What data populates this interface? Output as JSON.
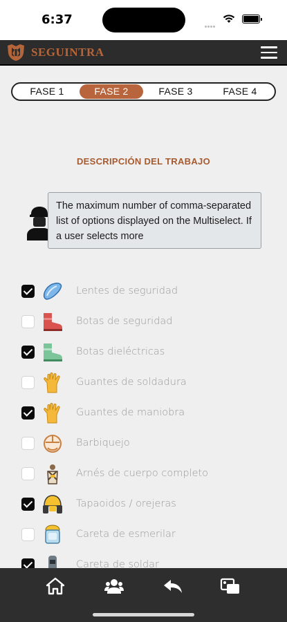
{
  "status_bar": {
    "time": "6:37"
  },
  "header": {
    "brand_name": "SEGUINTRA"
  },
  "phases": [
    {
      "label": "FASE 1",
      "active": false
    },
    {
      "label": "FASE 2",
      "active": true
    },
    {
      "label": "FASE 3",
      "active": false
    },
    {
      "label": "FASE 4",
      "active": false
    }
  ],
  "section": {
    "title": "DESCRIPCIÓN DEL TRABAJO",
    "worker_icon": "worker-helmet-icon",
    "tooltip_text": "The maximum number of comma-separated list of options displayed on the Multiselect. If a user selects more"
  },
  "checklist": [
    {
      "label": "Lentes de seguridad",
      "checked": true,
      "icon": "safety-glasses-icon"
    },
    {
      "label": "Botas de seguridad",
      "checked": false,
      "icon": "red-boot-icon"
    },
    {
      "label": "Botas dieléctricas",
      "checked": true,
      "icon": "green-boot-icon"
    },
    {
      "label": "Guantes de soldadura",
      "checked": false,
      "icon": "glove-icon"
    },
    {
      "label": "Guantes de maniobra",
      "checked": true,
      "icon": "glove-icon"
    },
    {
      "label": "Barbiquejo",
      "checked": false,
      "icon": "chin-strap-icon"
    },
    {
      "label": "Arnés de cuerpo completo",
      "checked": false,
      "icon": "harness-icon"
    },
    {
      "label": "Tapaoidos / orejeras",
      "checked": true,
      "icon": "ear-muffs-icon"
    },
    {
      "label": "Careta de esmerilar",
      "checked": false,
      "icon": "face-shield-icon"
    },
    {
      "label": "Careta de soldar",
      "checked": true,
      "icon": "welding-mask-icon"
    }
  ],
  "nav": [
    {
      "icon": "home-icon"
    },
    {
      "icon": "people-icon"
    },
    {
      "icon": "reply-icon"
    },
    {
      "icon": "gallery-icon"
    }
  ],
  "colors": {
    "accent": "#b8643c",
    "header_bg": "#2d2c2c",
    "section_title": "#a65a2f"
  }
}
